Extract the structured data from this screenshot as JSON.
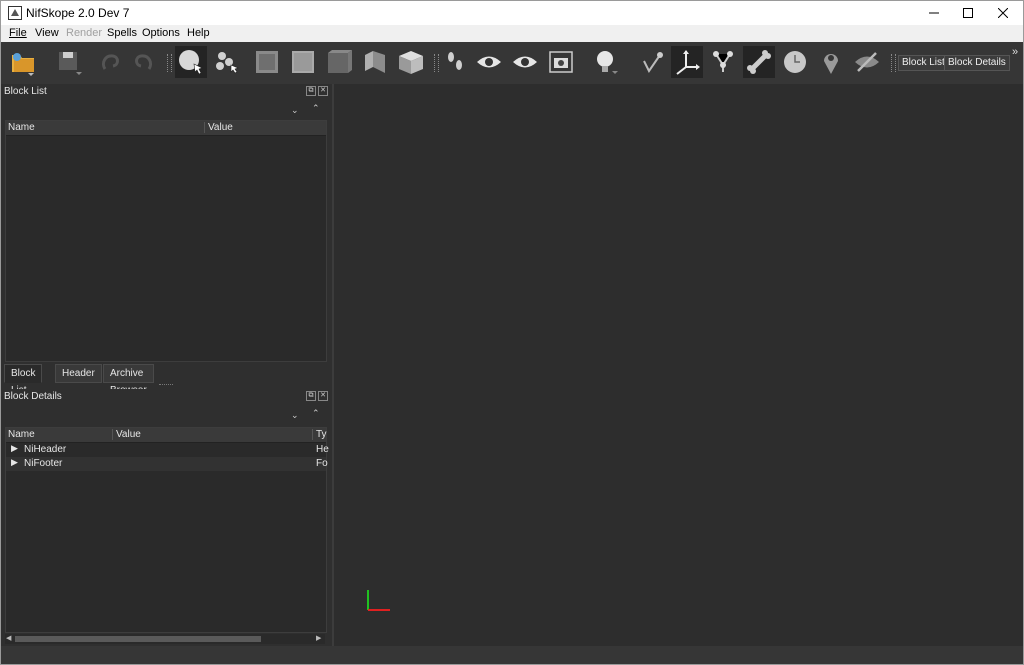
{
  "window": {
    "title": "NifSkope 2.0 Dev 7"
  },
  "menu": {
    "file": "File",
    "view": "View",
    "render": "Render",
    "spells": "Spells",
    "options": "Options",
    "help": "Help"
  },
  "toolbar": {
    "block_list_btn": "Block List",
    "block_details_btn": "Block Details",
    "overflow": "»"
  },
  "block_list": {
    "title": "Block List",
    "columns": [
      "Name",
      "Value"
    ]
  },
  "tabs": [
    "Block List",
    "Header",
    "Archive Browser"
  ],
  "block_details": {
    "title": "Block Details",
    "columns": [
      "Name",
      "Value",
      "Ty"
    ],
    "rows": [
      {
        "name": "NiHeader",
        "type": "He"
      },
      {
        "name": "NiFooter",
        "type": "Fo"
      }
    ]
  },
  "colors": {
    "axis_x": "#e02020",
    "axis_y": "#20c020"
  }
}
